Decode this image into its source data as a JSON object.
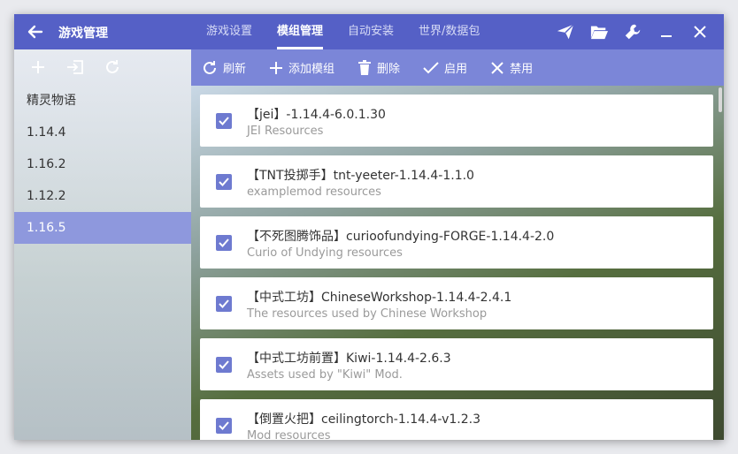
{
  "header": {
    "title": "游戏管理",
    "tabs": [
      {
        "label": "游戏设置"
      },
      {
        "label": "模组管理"
      },
      {
        "label": "自动安装"
      },
      {
        "label": "世界/数据包"
      }
    ],
    "active_tab": "模组管理",
    "icons": [
      "send-icon",
      "folder-open-icon",
      "wrench-icon",
      "minimize-icon",
      "close-icon"
    ],
    "accent_color": "#5560c6"
  },
  "sidebar": {
    "toolbar_icons": [
      "add-icon",
      "import-icon",
      "refresh-icon"
    ],
    "items": [
      {
        "label": "精灵物语"
      },
      {
        "label": "1.14.4"
      },
      {
        "label": "1.16.2"
      },
      {
        "label": "1.12.2"
      },
      {
        "label": "1.16.5"
      }
    ],
    "selected": "1.16.5",
    "selected_color": "#8e98dd"
  },
  "toolbar": {
    "refresh_label": "刷新",
    "add_mod_label": "添加模组",
    "delete_label": "删除",
    "enable_label": "启用",
    "disable_label": "禁用",
    "color": "#7b86d8"
  },
  "mods": [
    {
      "name": "【jei】-1.14.4-6.0.1.30",
      "description": "JEI Resources",
      "checked": true
    },
    {
      "name": "【TNT投掷手】tnt-yeeter-1.14.4-1.1.0",
      "description": "examplemod resources",
      "checked": true
    },
    {
      "name": "【不死图腾饰品】curioofundying-FORGE-1.14.4-2.0",
      "description": "Curio of Undying resources",
      "checked": true
    },
    {
      "name": "【中式工坊】ChineseWorkshop-1.14.4-2.4.1",
      "description": "The resources used by Chinese Workshop",
      "checked": true
    },
    {
      "name": "【中式工坊前置】Kiwi-1.14.4-2.6.3",
      "description": "Assets used by \"Kiwi\" Mod.",
      "checked": true
    },
    {
      "name": "【倒置火把】ceilingtorch-1.14.4-v1.2.3",
      "description": "Mod resources",
      "checked": true
    }
  ]
}
